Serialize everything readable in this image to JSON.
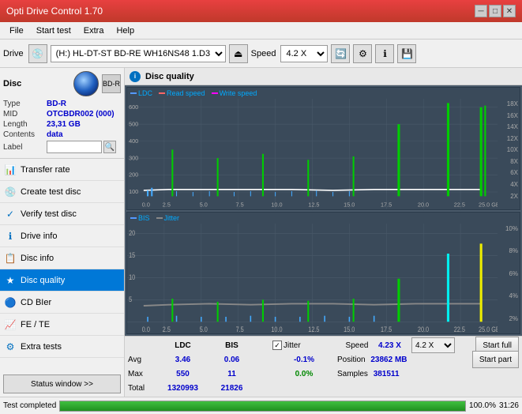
{
  "app": {
    "title": "Opti Drive Control 1.70",
    "title_bar_bg": "#c0392b"
  },
  "menu": {
    "items": [
      "File",
      "Start test",
      "Extra",
      "Help"
    ]
  },
  "toolbar": {
    "drive_label": "Drive",
    "drive_value": "(H:) HL-DT-ST BD-RE  WH16NS48 1.D3",
    "speed_label": "Speed",
    "speed_value": "4.2 X"
  },
  "disc": {
    "header": "Disc",
    "type_label": "Type",
    "type_value": "BD-R",
    "mid_label": "MID",
    "mid_value": "OTCBDR002 (000)",
    "length_label": "Length",
    "length_value": "23,31 GB",
    "contents_label": "Contents",
    "contents_value": "data",
    "label_label": "Label",
    "label_placeholder": ""
  },
  "nav": {
    "items": [
      {
        "id": "transfer-rate",
        "label": "Transfer rate",
        "icon": "📊",
        "active": false
      },
      {
        "id": "create-test-disc",
        "label": "Create test disc",
        "icon": "💿",
        "active": false
      },
      {
        "id": "verify-test-disc",
        "label": "Verify test disc",
        "icon": "✓",
        "active": false
      },
      {
        "id": "drive-info",
        "label": "Drive info",
        "icon": "ℹ",
        "active": false
      },
      {
        "id": "disc-info",
        "label": "Disc info",
        "icon": "📋",
        "active": false
      },
      {
        "id": "disc-quality",
        "label": "Disc quality",
        "icon": "★",
        "active": true
      },
      {
        "id": "cd-bier",
        "label": "CD BIer",
        "icon": "🔵",
        "active": false
      },
      {
        "id": "fe-te",
        "label": "FE / TE",
        "icon": "📈",
        "active": false
      },
      {
        "id": "extra-tests",
        "label": "Extra tests",
        "icon": "⚙",
        "active": false
      }
    ]
  },
  "status_window_btn": "Status window >>",
  "disc_quality": {
    "title": "Disc quality",
    "legend": {
      "ldc": "LDC",
      "read_speed": "Read speed",
      "write_speed": "Write speed",
      "bis": "BIS",
      "jitter": "Jitter"
    }
  },
  "y_axis_top": [
    "18X",
    "16X",
    "14X",
    "12X",
    "10X",
    "8X",
    "6X",
    "4X",
    "2X"
  ],
  "y_axis_top_left": [
    "600",
    "500",
    "400",
    "300",
    "200",
    "100"
  ],
  "y_axis_bottom": [
    "10%",
    "8%",
    "6%",
    "4%",
    "2%"
  ],
  "x_axis": [
    "0.0",
    "2.5",
    "5.0",
    "7.5",
    "10.0",
    "12.5",
    "15.0",
    "17.5",
    "20.0",
    "22.5",
    "25.0 GB"
  ],
  "stats": {
    "headers": [
      "",
      "LDC",
      "BIS",
      "",
      "Jitter",
      "Speed"
    ],
    "avg_label": "Avg",
    "avg_ldc": "3.46",
    "avg_bis": "0.06",
    "avg_jitter": "-0.1%",
    "max_label": "Max",
    "max_ldc": "550",
    "max_bis": "11",
    "max_jitter": "0.0%",
    "total_label": "Total",
    "total_ldc": "1320993",
    "total_bis": "21826",
    "speed_label": "Speed",
    "speed_value": "4.23 X",
    "position_label": "Position",
    "position_value": "23862 MB",
    "samples_label": "Samples",
    "samples_value": "381511",
    "jitter_checked": true,
    "speed_select": "4.2 X"
  },
  "buttons": {
    "start_full": "Start full",
    "start_part": "Start part"
  },
  "bottom": {
    "status_text": "Test completed",
    "progress_percent": 100,
    "time": "31:26"
  }
}
